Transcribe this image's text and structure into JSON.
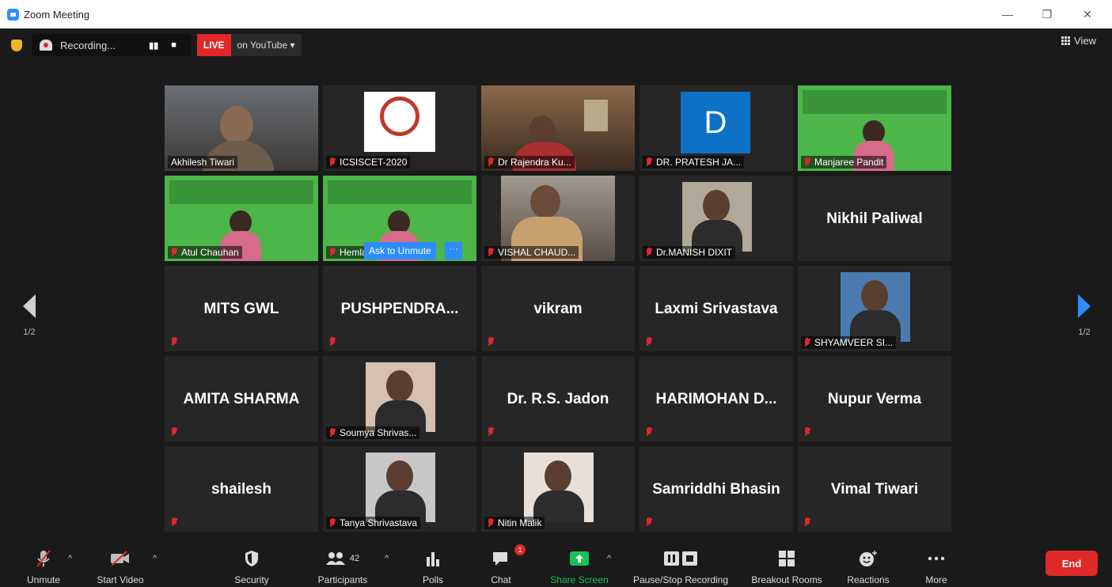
{
  "window": {
    "title": "Zoom Meeting",
    "minimize": "—",
    "restore": "❐",
    "close": "✕"
  },
  "topbar": {
    "recording_label": "Recording...",
    "pause_label": "▮▮",
    "stop_label": "■",
    "live_label": "LIVE",
    "live_destination": "on YouTube ▾",
    "view_label": "View"
  },
  "pager": {
    "left": "1/2",
    "right": "1/2"
  },
  "ask_to_unmute": {
    "label": "Ask to Unmute",
    "more": "···"
  },
  "tiles": [
    {
      "name": "Akhilesh Tiwari",
      "type": "video",
      "active": true,
      "muted": false
    },
    {
      "name": "ICSISCET-2020",
      "type": "logo",
      "muted": true
    },
    {
      "name": "Dr Rajendra Ku...",
      "type": "video",
      "muted": true
    },
    {
      "name": "DR. PRATESH JA...",
      "type": "avatar",
      "avatar_letter": "D",
      "muted": true
    },
    {
      "name": "Manjaree Pandit",
      "type": "share",
      "muted": true
    },
    {
      "name": "Atul Chauhan",
      "type": "share",
      "muted": true
    },
    {
      "name": "Hemlata Arya",
      "type": "share",
      "muted": true
    },
    {
      "name": "VISHAL CHAUD...",
      "type": "video",
      "muted": true
    },
    {
      "name": "Dr.MANISH DIXIT",
      "type": "photo",
      "muted": true
    },
    {
      "name": "Nikhil Paliwal",
      "type": "text",
      "muted": false
    },
    {
      "name": "MITS GWL",
      "type": "text",
      "muted": true
    },
    {
      "name": "PUSHPENDRA...",
      "type": "text",
      "muted": true
    },
    {
      "name": "vikram",
      "type": "text",
      "muted": true
    },
    {
      "name": "Laxmi Srivastava",
      "type": "text",
      "muted": true
    },
    {
      "name": "SHYAMVEER SI...",
      "type": "photo",
      "muted": true
    },
    {
      "name": "AMITA SHARMA",
      "type": "text",
      "muted": true
    },
    {
      "name": "Soumya Shrivas...",
      "type": "photo",
      "muted": true
    },
    {
      "name": "Dr. R.S. Jadon",
      "type": "text",
      "muted": true
    },
    {
      "name": "HARIMOHAN D...",
      "type": "text",
      "muted": true
    },
    {
      "name": "Nupur Verma",
      "type": "text",
      "muted": true
    },
    {
      "name": "shailesh",
      "type": "text",
      "muted": true
    },
    {
      "name": "Tanya Shrivastava",
      "type": "photo",
      "muted": true
    },
    {
      "name": "Nitin Malik",
      "type": "photo",
      "muted": true
    },
    {
      "name": "Samriddhi Bhasin",
      "type": "text",
      "muted": true
    },
    {
      "name": "Vimal Tiwari",
      "type": "text",
      "muted": true
    }
  ],
  "toolbar": {
    "unmute": "Unmute",
    "start_video": "Start Video",
    "security": "Security",
    "participants": "Participants",
    "participants_count": "42",
    "polls": "Polls",
    "chat": "Chat",
    "chat_badge": "1",
    "share_screen": "Share Screen",
    "pause_stop_recording": "Pause/Stop Recording",
    "breakout_rooms": "Breakout Rooms",
    "reactions": "Reactions",
    "more": "More",
    "end": "End"
  },
  "colors": {
    "accent": "#2d8cff",
    "end_red": "#e02828",
    "share_green": "#19c15b",
    "active_border": "#b8e04c"
  }
}
